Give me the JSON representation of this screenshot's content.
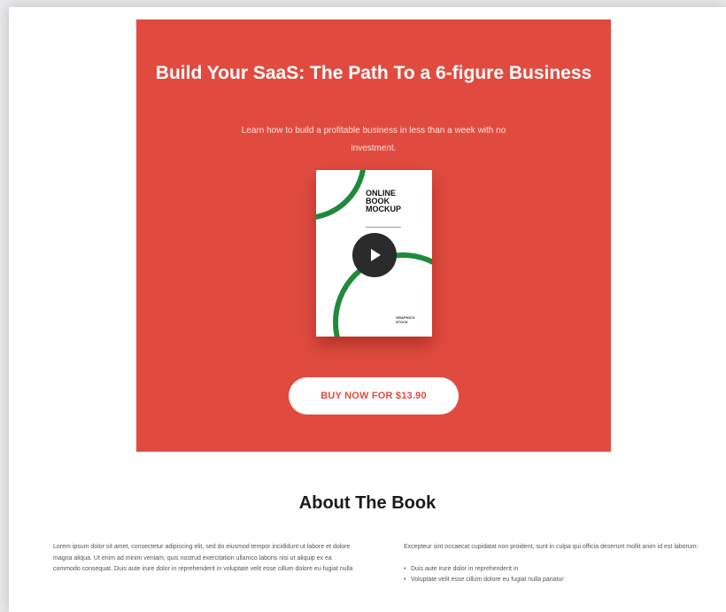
{
  "hero": {
    "title": "Build Your SaaS: The Path To a 6-figure Business",
    "subtitle": "Learn how to build a profitable business in less than a week with no investment.",
    "background_color": "#e14b3f",
    "book_cover": {
      "title": "ONLINE\nBOOK\nMOCKUP",
      "publisher": "GRAPHICS STOCK",
      "arc_color": "#1f8a3a"
    },
    "play_icon": "play-icon",
    "buy_button_label": "BUY NOW FOR $13.90"
  },
  "about": {
    "title": "About The Book",
    "left_paragraph": "Lorem ipsum dolor sit amet, consectetur adipiscing elit, sed do eiusmod tempor incididunt ut labore et dolore magna aliqua. Ut enim ad minim veniam, quis nostrud exercitation ullamco laboris nisi ut aliquip ex ea commodo consequat. Duis aute irure dolor in reprehenderit in voluptate velit esse cillum dolore eu fugiat nulla",
    "right_paragraph": "Excepteur sint occaecat cupidatat non proident, sunt in culpa qui officia deserunt mollit anim id est laborum:",
    "bullets": [
      "Duis aute irure dolor in reprehenderit in",
      "Voluptate velit esse cillum dolore eu fugiat nulla pariatur"
    ]
  }
}
